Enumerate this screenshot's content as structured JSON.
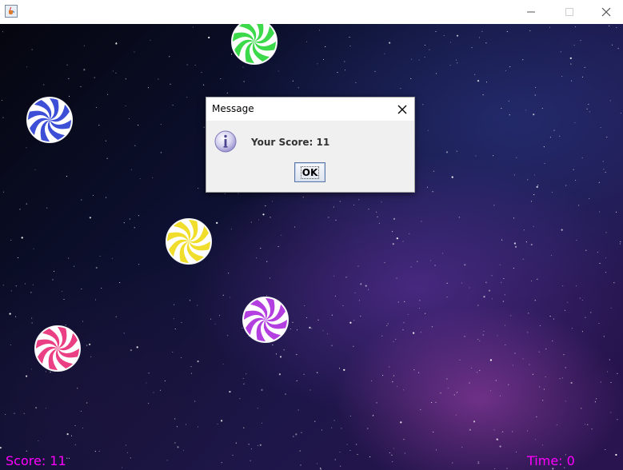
{
  "window": {
    "title": "",
    "app_icon": "java-coffee-cup-icon",
    "controls": [
      "minimize-icon",
      "maximize-icon",
      "close-icon"
    ]
  },
  "game": {
    "score_label": "Score: 11",
    "time_label": "Time: 0",
    "hud_color": "#ff00ff",
    "candies": [
      {
        "color": "green",
        "hex": "#3cd94a"
      },
      {
        "color": "blue",
        "hex": "#3d4fd6"
      },
      {
        "color": "yellow",
        "hex": "#f1de2c"
      },
      {
        "color": "purple",
        "hex": "#b43fe0"
      },
      {
        "color": "pink",
        "hex": "#ea3f82"
      }
    ]
  },
  "dialog": {
    "title": "Message",
    "message": "Your Score: 11",
    "ok_label": "OK",
    "icon": "information-icon"
  }
}
